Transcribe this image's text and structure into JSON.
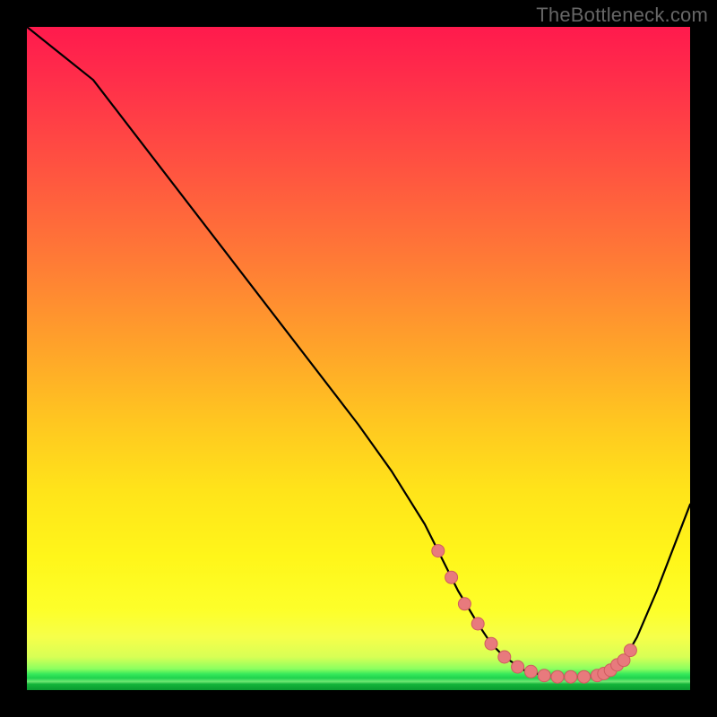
{
  "watermark": "TheBottleneck.com",
  "chart_data": {
    "type": "line",
    "title": "",
    "xlabel": "",
    "ylabel": "",
    "xlim": [
      0,
      100
    ],
    "ylim": [
      0,
      100
    ],
    "x": [
      0,
      5,
      10,
      20,
      30,
      40,
      50,
      55,
      60,
      62,
      65,
      68,
      70,
      72,
      75,
      78,
      80,
      82,
      84,
      86,
      88,
      90,
      92,
      95,
      100
    ],
    "values": [
      100,
      96,
      92,
      79,
      66,
      53,
      40,
      33,
      25,
      21,
      15,
      10,
      7,
      5,
      3,
      2.2,
      2.0,
      2.0,
      2.0,
      2.2,
      3,
      4.5,
      8,
      15,
      28
    ],
    "markers": {
      "x": [
        62,
        64,
        66,
        68,
        70,
        72,
        74,
        76,
        78,
        80,
        82,
        84,
        86,
        87,
        88,
        89,
        90,
        91
      ],
      "y": [
        21,
        17,
        13,
        10,
        7,
        5,
        3.5,
        2.8,
        2.2,
        2.0,
        2.0,
        2.0,
        2.2,
        2.5,
        3,
        3.8,
        4.5,
        6
      ]
    },
    "colors": {
      "line": "#000000",
      "marker_fill": "#e87a7d",
      "marker_stroke": "#cf5c5f"
    }
  }
}
